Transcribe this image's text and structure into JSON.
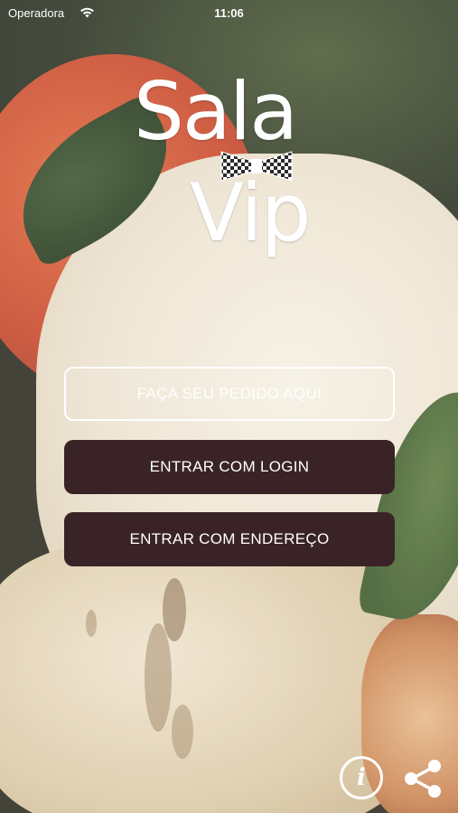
{
  "status_bar": {
    "carrier": "Operadora",
    "time": "11:06"
  },
  "logo": {
    "line1": "Sala",
    "line2": "Vip"
  },
  "buttons": {
    "order_label": "FAÇA SEU PEDIDO AQUI",
    "login_label": "ENTRAR COM LOGIN",
    "address_label": "ENTRAR COM ENDEREÇO"
  },
  "footer": {
    "info_label": "i",
    "info_icon": "info-icon",
    "share_icon": "share-icon"
  },
  "colors": {
    "button_dark": "#3a2327",
    "text": "#ffffff"
  }
}
